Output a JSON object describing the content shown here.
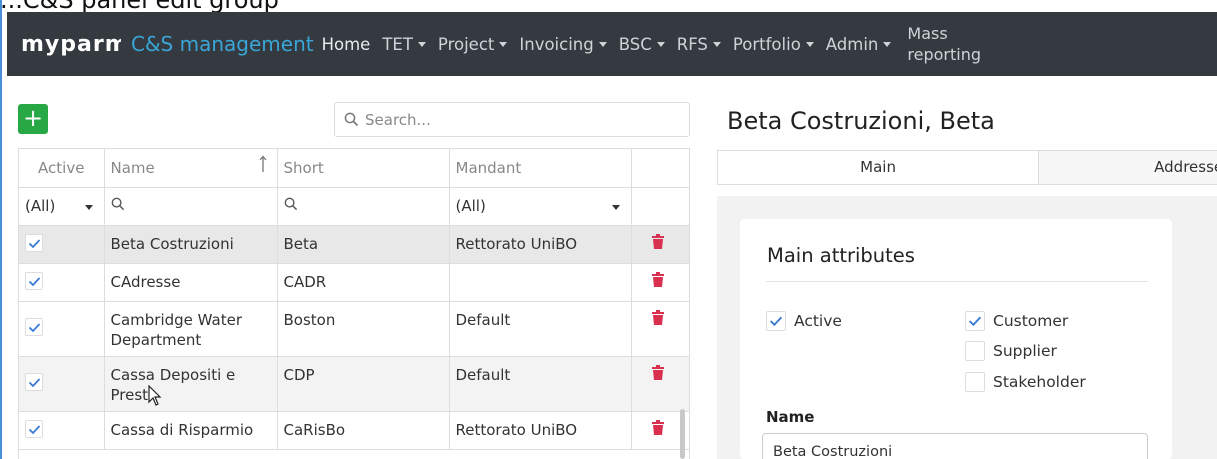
{
  "top_text": "...C&S panel edit group",
  "navbar": {
    "logo": "myparm",
    "brand": "C&S management",
    "items": [
      {
        "label": "Home",
        "dropdown": false
      },
      {
        "label": "TET",
        "dropdown": true
      },
      {
        "label": "Project",
        "dropdown": true
      },
      {
        "label": "Invoicing",
        "dropdown": true
      },
      {
        "label": "BSC",
        "dropdown": true
      },
      {
        "label": "RFS",
        "dropdown": true
      },
      {
        "label": "Portfolio",
        "dropdown": true
      },
      {
        "label": "Admin",
        "dropdown": true
      }
    ],
    "mass_reporting": "Mass reporting"
  },
  "toolbar": {
    "add_label": "+",
    "search_placeholder": "Search..."
  },
  "grid": {
    "columns": [
      "Active",
      "Name",
      "Short",
      "Mandant",
      ""
    ],
    "sort": {
      "column": "Name",
      "direction": "ascending"
    },
    "filters": {
      "active": "(All)",
      "mandant": "(All)"
    },
    "rows": [
      {
        "active": true,
        "name": "Beta Costruzioni",
        "short": "Beta",
        "mandant": "Rettorato UniBO",
        "selected": true
      },
      {
        "active": true,
        "name": "CAdresse",
        "short": "CADR",
        "mandant": "",
        "selected": false
      },
      {
        "active": true,
        "name": "Cambridge Water Department",
        "short": "Boston",
        "mandant": "Default",
        "selected": false
      },
      {
        "active": true,
        "name": "Cassa Depositi e Presti",
        "short": "CDP",
        "mandant": "Default",
        "selected": false
      },
      {
        "active": true,
        "name": "Cassa di Risparmio",
        "short": "CaRisBo",
        "mandant": "Rettorato UniBO",
        "selected": false
      }
    ]
  },
  "detail": {
    "title": "Beta Costruzioni, Beta",
    "tabs": [
      "Main",
      "Addresses"
    ],
    "active_tab": "Main",
    "section_title": "Main attributes",
    "checkboxes": [
      {
        "label": "Active",
        "checked": true
      },
      {
        "label": "Customer",
        "checked": true
      },
      {
        "label": "Supplier",
        "checked": false
      },
      {
        "label": "Stakeholder",
        "checked": false
      }
    ],
    "name_label": "Name",
    "name_value": "Beta Costruzioni"
  },
  "colors": {
    "navbar_bg": "#343a40",
    "brand": "#3aa6d8",
    "add_button": "#28a745",
    "trash": "#d9304f",
    "check": "#3a7bd5"
  }
}
